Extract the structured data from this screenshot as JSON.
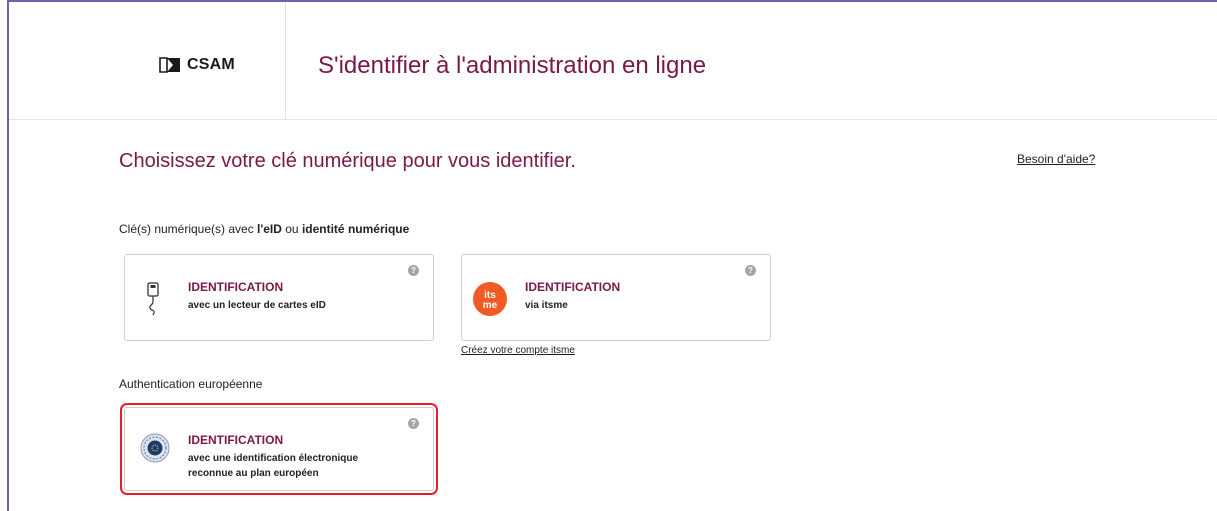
{
  "header": {
    "logo_text": "CSAM",
    "title": "S'identifier à l'administration en ligne"
  },
  "main": {
    "heading": "Choisissez votre clé numérique pour vous identifier.",
    "help_link": "Besoin d'aide?",
    "section_eid": {
      "prefix": "Clé(s) numérique(s) avec ",
      "bold1": "l'eID",
      "middle": " ou ",
      "bold2": "identité numérique"
    },
    "card_eid": {
      "title": "IDENTIFICATION",
      "subtitle": "avec un lecteur de cartes eID",
      "help": "?"
    },
    "card_itsme": {
      "title": "IDENTIFICATION",
      "subtitle": "via itsme",
      "help": "?",
      "logo_text_1": "its",
      "logo_text_2": "me"
    },
    "create_itsme_link": "Créez votre compte itsme",
    "section_eu": "Authentication européenne",
    "card_eu": {
      "title": "IDENTIFICATION",
      "subtitle_line1": "avec une identification électronique",
      "subtitle_line2": "reconnue au plan européen",
      "help": "?"
    }
  },
  "colors": {
    "brand": "#7a1846",
    "itsme_orange": "#ef5b23",
    "selection": "#e0202a",
    "frame": "#6b63b5"
  }
}
